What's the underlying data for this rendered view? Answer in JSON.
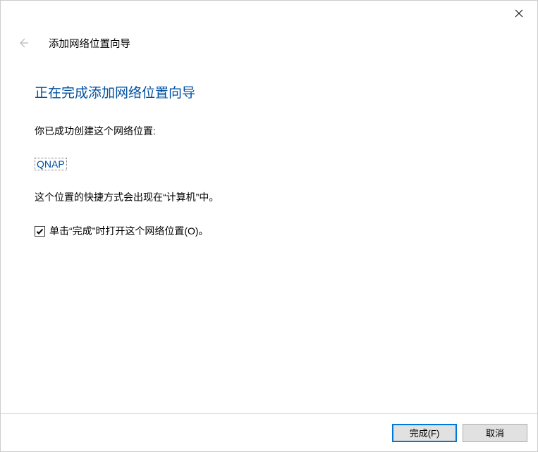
{
  "titlebar": {
    "close_icon": "close"
  },
  "header": {
    "wizard_name": "添加网络位置向导"
  },
  "main": {
    "heading": "正在完成添加网络位置向导",
    "success_text": "你已成功创建这个网络位置:",
    "location_name": "QNAP",
    "shortcut_text": "这个位置的快捷方式会出现在“计算机”中。",
    "checkbox_label": "单击“完成”时打开这个网络位置(O)。",
    "checkbox_checked": true
  },
  "footer": {
    "finish_label": "完成(F)",
    "cancel_label": "取消"
  }
}
